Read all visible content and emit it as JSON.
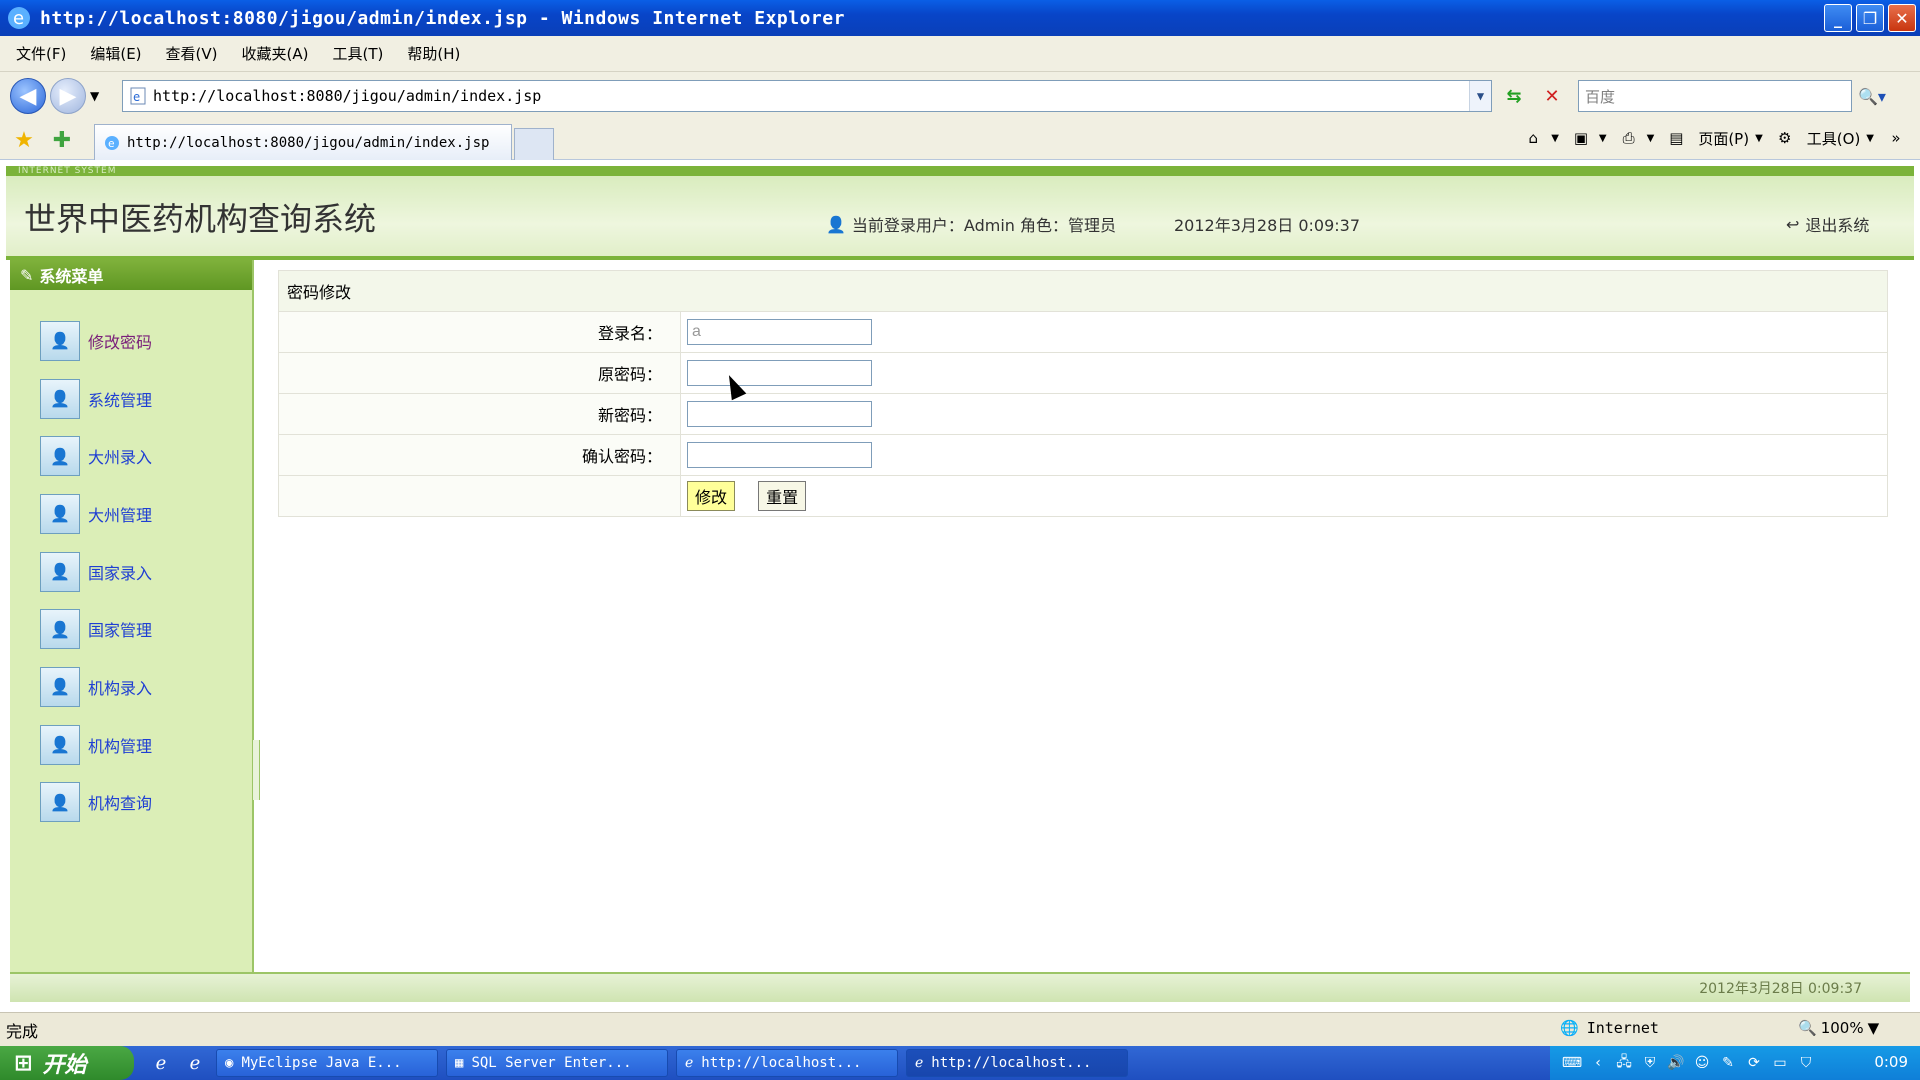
{
  "window": {
    "title": "http://localhost:8080/jigou/admin/index.jsp - Windows Internet Explorer"
  },
  "menubar": [
    "文件(F)",
    "编辑(E)",
    "查看(V)",
    "收藏夹(A)",
    "工具(T)",
    "帮助(H)"
  ],
  "address": {
    "url": "http://localhost:8080/jigou/admin/index.jsp",
    "search_placeholder": "百度"
  },
  "tab": {
    "label": "http://localhost:8080/jigou/admin/index.jsp"
  },
  "command_bar": {
    "page_label": "页面(P)",
    "tools_label": "工具(O)"
  },
  "header": {
    "brand_strip": "INTERNET SYSTEM",
    "system_title": "世界中医药机构查询系统",
    "login_info": "当前登录用户：Admin 角色：管理员",
    "datetime": "2012年3月28日 0:09:37",
    "logout": "退出系统"
  },
  "sidebar": {
    "title": "系统菜单",
    "items": [
      "修改密码",
      "系统管理",
      "大州录入",
      "大州管理",
      "国家录入",
      "国家管理",
      "机构录入",
      "机构管理",
      "机构查询"
    ],
    "active_index": 0
  },
  "form": {
    "title": "密码修改",
    "fields": [
      {
        "label": "登录名：",
        "value": "a"
      },
      {
        "label": "原密码：",
        "value": ""
      },
      {
        "label": "新密码：",
        "value": ""
      },
      {
        "label": "确认密码：",
        "value": ""
      }
    ],
    "submit_label": "修改",
    "reset_label": "重置"
  },
  "footer": {
    "datetime": "2012年3月28日 0:09:37"
  },
  "statusbar": {
    "text": "完成",
    "zone": "Internet",
    "zoom": "100%"
  },
  "taskbar": {
    "start": "开始",
    "tasks": [
      "MyEclipse Java E...",
      "SQL Server Enter...",
      "http://localhost...",
      "http://localhost..."
    ],
    "active_task": 3,
    "clock": "0:09"
  },
  "colors": {
    "accent_green": "#7bb33a",
    "nav_link": "#1f3fd3",
    "active_nav_link": "#7a1f7a"
  }
}
